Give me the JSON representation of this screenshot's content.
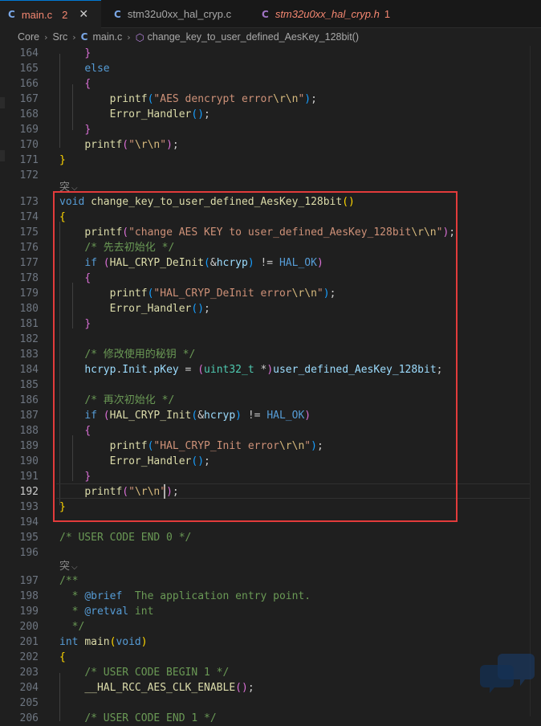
{
  "tabs": [
    {
      "icon": "C",
      "label": "main.c",
      "modified": "2",
      "active": true
    },
    {
      "icon": "C",
      "label": "stm32u0xx_hal_cryp.c"
    },
    {
      "icon": "C",
      "label": "stm32u0xx_hal_cryp.h",
      "modified": "1"
    }
  ],
  "breadcrumb": {
    "items": [
      "Core",
      "Src",
      "main.c",
      "change_key_to_user_defined_AesKey_128bit()"
    ]
  },
  "codelens": [
    "突",
    "突"
  ],
  "colors": {
    "highlight_box": "#e23b3b",
    "background": "#1f1f1f",
    "active_tab_border": "#0078d4"
  },
  "lines": [
    {
      "n": "164",
      "tokens": [
        [
          "    ",
          ""
        ],
        [
          "}",
          "p2"
        ]
      ]
    },
    {
      "n": "165",
      "tokens": [
        [
          "    ",
          ""
        ],
        [
          "else",
          "kw"
        ]
      ]
    },
    {
      "n": "166",
      "tokens": [
        [
          "    ",
          ""
        ],
        [
          "{",
          "p2"
        ]
      ]
    },
    {
      "n": "167",
      "tokens": [
        [
          "        ",
          ""
        ],
        [
          "printf",
          "fn"
        ],
        [
          "(",
          "p3"
        ],
        [
          "\"AES dencrypt error",
          "str"
        ],
        [
          "\\r\\n",
          "esc"
        ],
        [
          "\"",
          "str"
        ],
        [
          ")",
          "p3"
        ],
        [
          ";",
          ""
        ]
      ]
    },
    {
      "n": "168",
      "tokens": [
        [
          "        ",
          ""
        ],
        [
          "Error_Handler",
          "fn"
        ],
        [
          "()",
          "p3"
        ],
        [
          ";",
          ""
        ]
      ]
    },
    {
      "n": "169",
      "tokens": [
        [
          "    ",
          ""
        ],
        [
          "}",
          "p2"
        ]
      ]
    },
    {
      "n": "170",
      "tokens": [
        [
          "    ",
          ""
        ],
        [
          "printf",
          "fn"
        ],
        [
          "(",
          "p2"
        ],
        [
          "\"",
          "str"
        ],
        [
          "\\r\\n",
          "esc"
        ],
        [
          "\"",
          "str"
        ],
        [
          ")",
          "p2"
        ],
        [
          ";",
          ""
        ]
      ]
    },
    {
      "n": "171",
      "tokens": [
        [
          "}",
          "p1"
        ]
      ]
    },
    {
      "n": "172",
      "tokens": []
    },
    {
      "n": "173",
      "tokens": [
        [
          "void",
          "kw"
        ],
        [
          " ",
          ""
        ],
        [
          "change_key_to_user_defined_AesKey_128bit",
          "fn"
        ],
        [
          "()",
          "p1"
        ]
      ]
    },
    {
      "n": "174",
      "tokens": [
        [
          "{",
          "p1"
        ]
      ]
    },
    {
      "n": "175",
      "tokens": [
        [
          "    ",
          ""
        ],
        [
          "printf",
          "fn"
        ],
        [
          "(",
          "p2"
        ],
        [
          "\"change AES KEY to user_defined_AesKey_128bit",
          "str"
        ],
        [
          "\\r\\n",
          "esc"
        ],
        [
          "\"",
          "str"
        ],
        [
          ")",
          "p2"
        ],
        [
          ";",
          ""
        ]
      ]
    },
    {
      "n": "176",
      "tokens": [
        [
          "    ",
          ""
        ],
        [
          "/* 先去初始化 */",
          "cm"
        ]
      ]
    },
    {
      "n": "177",
      "tokens": [
        [
          "    ",
          ""
        ],
        [
          "if",
          "kw"
        ],
        [
          " ",
          ""
        ],
        [
          "(",
          "p2"
        ],
        [
          "HAL_CRYP_DeInit",
          "fn"
        ],
        [
          "(",
          "p3"
        ],
        [
          "&",
          ""
        ],
        [
          "hcryp",
          "var"
        ],
        [
          ")",
          "p3"
        ],
        [
          " != ",
          ""
        ],
        [
          "HAL_OK",
          "mac"
        ],
        [
          ")",
          "p2"
        ]
      ]
    },
    {
      "n": "178",
      "tokens": [
        [
          "    ",
          ""
        ],
        [
          "{",
          "p2"
        ]
      ]
    },
    {
      "n": "179",
      "tokens": [
        [
          "        ",
          ""
        ],
        [
          "printf",
          "fn"
        ],
        [
          "(",
          "p3"
        ],
        [
          "\"HAL_CRYP_DeInit error",
          "str"
        ],
        [
          "\\r\\n",
          "esc"
        ],
        [
          "\"",
          "str"
        ],
        [
          ")",
          "p3"
        ],
        [
          ";",
          ""
        ]
      ]
    },
    {
      "n": "180",
      "tokens": [
        [
          "        ",
          ""
        ],
        [
          "Error_Handler",
          "fn"
        ],
        [
          "()",
          "p3"
        ],
        [
          ";",
          ""
        ]
      ]
    },
    {
      "n": "181",
      "tokens": [
        [
          "    ",
          ""
        ],
        [
          "}",
          "p2"
        ]
      ]
    },
    {
      "n": "182",
      "tokens": []
    },
    {
      "n": "183",
      "tokens": [
        [
          "    ",
          ""
        ],
        [
          "/* 修改使用的秘钥 */",
          "cm"
        ]
      ]
    },
    {
      "n": "184",
      "tokens": [
        [
          "    ",
          ""
        ],
        [
          "hcryp",
          "var"
        ],
        [
          ".",
          ""
        ],
        [
          "Init",
          "var"
        ],
        [
          ".",
          ""
        ],
        [
          "pKey",
          "var"
        ],
        [
          " = ",
          ""
        ],
        [
          "(",
          "p2"
        ],
        [
          "uint32_t",
          "ty"
        ],
        [
          " *",
          ""
        ],
        [
          ")",
          "p2"
        ],
        [
          "user_defined_AesKey_128bit",
          "var"
        ],
        [
          ";",
          ""
        ]
      ]
    },
    {
      "n": "185",
      "tokens": []
    },
    {
      "n": "186",
      "tokens": [
        [
          "    ",
          ""
        ],
        [
          "/* 再次初始化 */",
          "cm"
        ]
      ]
    },
    {
      "n": "187",
      "tokens": [
        [
          "    ",
          ""
        ],
        [
          "if",
          "kw"
        ],
        [
          " ",
          ""
        ],
        [
          "(",
          "p2"
        ],
        [
          "HAL_CRYP_Init",
          "fn"
        ],
        [
          "(",
          "p3"
        ],
        [
          "&",
          ""
        ],
        [
          "hcryp",
          "var"
        ],
        [
          ")",
          "p3"
        ],
        [
          " != ",
          ""
        ],
        [
          "HAL_OK",
          "mac"
        ],
        [
          ")",
          "p2"
        ]
      ]
    },
    {
      "n": "188",
      "tokens": [
        [
          "    ",
          ""
        ],
        [
          "{",
          "p2"
        ]
      ]
    },
    {
      "n": "189",
      "tokens": [
        [
          "        ",
          ""
        ],
        [
          "printf",
          "fn"
        ],
        [
          "(",
          "p3"
        ],
        [
          "\"HAL_CRYP_Init error",
          "str"
        ],
        [
          "\\r\\n",
          "esc"
        ],
        [
          "\"",
          "str"
        ],
        [
          ")",
          "p3"
        ],
        [
          ";",
          ""
        ]
      ]
    },
    {
      "n": "190",
      "tokens": [
        [
          "        ",
          ""
        ],
        [
          "Error_Handler",
          "fn"
        ],
        [
          "()",
          "p3"
        ],
        [
          ";",
          ""
        ]
      ]
    },
    {
      "n": "191",
      "tokens": [
        [
          "    ",
          ""
        ],
        [
          "}",
          "p2"
        ]
      ]
    },
    {
      "n": "192",
      "tokens": [
        [
          "    ",
          ""
        ],
        [
          "printf",
          "fn"
        ],
        [
          "(",
          "p2"
        ],
        [
          "\"",
          "str"
        ],
        [
          "\\r\\n",
          "esc"
        ],
        [
          "\"",
          "str"
        ],
        [
          ")",
          "p2"
        ],
        [
          ";",
          ""
        ]
      ],
      "current": true
    },
    {
      "n": "193",
      "tokens": [
        [
          "}",
          "p1"
        ]
      ]
    },
    {
      "n": "194",
      "tokens": []
    },
    {
      "n": "195",
      "tokens": [
        [
          "/* USER CODE END 0 */",
          "cm"
        ]
      ]
    },
    {
      "n": "196",
      "tokens": []
    },
    {
      "n": "197",
      "tokens": [
        [
          "/**",
          "cm"
        ]
      ]
    },
    {
      "n": "198",
      "tokens": [
        [
          "  * ",
          "cm"
        ],
        [
          "@brief",
          "dkw"
        ],
        [
          "  The application entry point.",
          "cm"
        ]
      ]
    },
    {
      "n": "199",
      "tokens": [
        [
          "  * ",
          "cm"
        ],
        [
          "@retval",
          "dkw"
        ],
        [
          " int",
          "cm"
        ]
      ]
    },
    {
      "n": "200",
      "tokens": [
        [
          "  */",
          "cm"
        ]
      ]
    },
    {
      "n": "201",
      "tokens": [
        [
          "int",
          "kw"
        ],
        [
          " ",
          ""
        ],
        [
          "main",
          "fn"
        ],
        [
          "(",
          "p1"
        ],
        [
          "void",
          "kw"
        ],
        [
          ")",
          "p1"
        ]
      ]
    },
    {
      "n": "202",
      "tokens": [
        [
          "{",
          "p1"
        ]
      ]
    },
    {
      "n": "203",
      "tokens": [
        [
          "    ",
          ""
        ],
        [
          "/* USER CODE BEGIN 1 */",
          "cm"
        ]
      ]
    },
    {
      "n": "204",
      "tokens": [
        [
          "    ",
          ""
        ],
        [
          "__HAL_RCC_AES_CLK_ENABLE",
          "fn"
        ],
        [
          "()",
          "p2"
        ],
        [
          ";",
          ""
        ]
      ]
    },
    {
      "n": "205",
      "tokens": []
    },
    {
      "n": "206",
      "tokens": [
        [
          "    ",
          ""
        ],
        [
          "/* USER CODE END 1 */",
          "cm"
        ]
      ]
    }
  ]
}
